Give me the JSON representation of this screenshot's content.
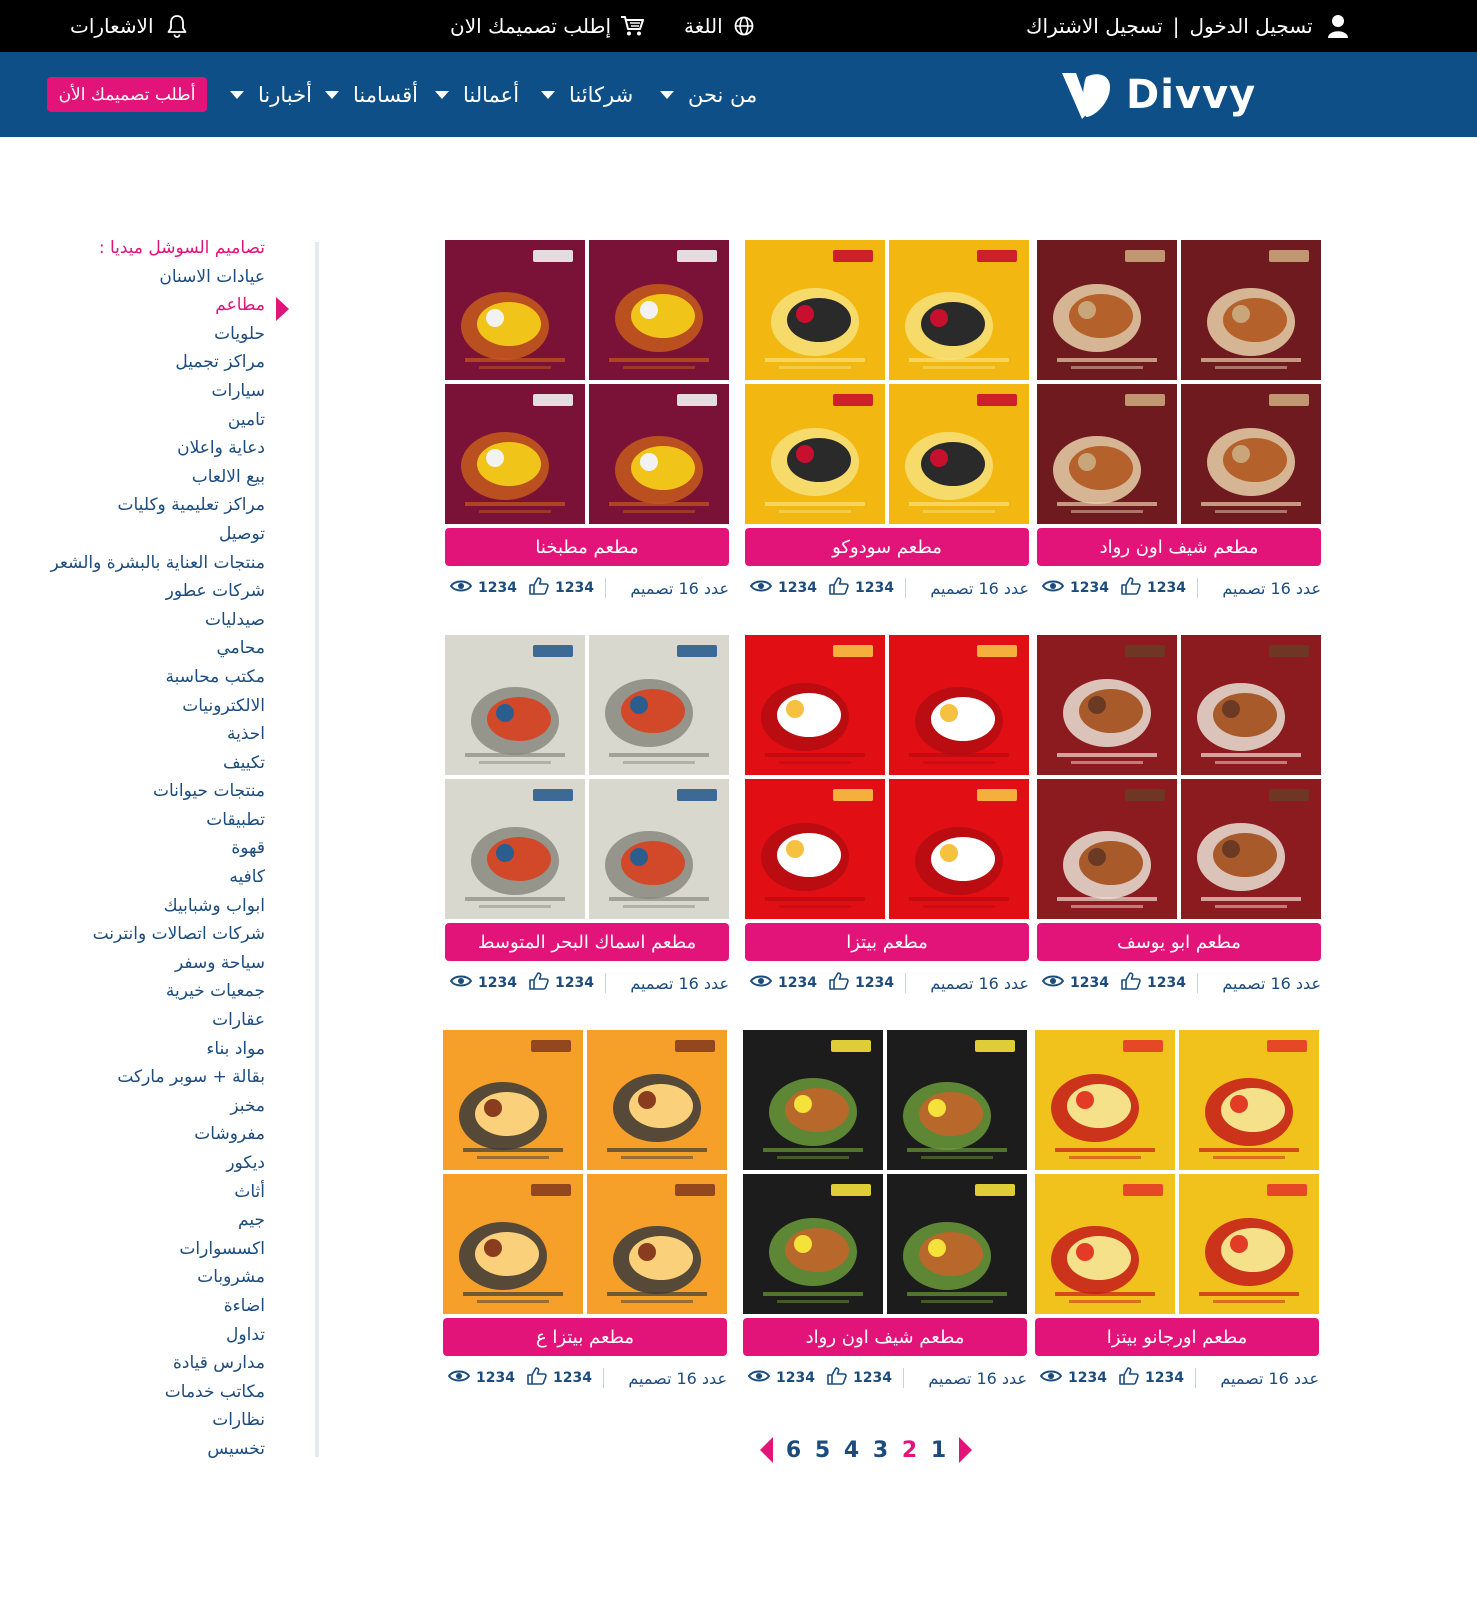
{
  "topbar": {
    "login": "تسجيل الدخول",
    "divider": "|",
    "register": "تسجيل الاشتراك",
    "language": "اللغة",
    "order_design": "إطلب تصميمك الان",
    "notifications": "الاشعارات"
  },
  "logo": {
    "text": "Divvy"
  },
  "nav": {
    "items": [
      "من نحن",
      "شركائنا",
      "أعمالنا",
      "أقسامنا",
      "أخبارنا"
    ],
    "cta": "أطلب تصميمك الأن"
  },
  "sidebar": {
    "title": "تصاميم السوشل ميديا :",
    "active_index": 1,
    "items": [
      "عيادات الاسنان",
      "مطاعم",
      "حلويات",
      "مراكز تجميل",
      "سيارات",
      "تامين",
      "دعاية واعلان",
      "بيع الالعاب",
      "مراكز تعليمية وكليات",
      "توصيل",
      "منتجات العناية بالبشرة والشعر",
      "شركات عطور",
      "صيدليات",
      "محامي",
      "مكتب محاسبة",
      "الالكترونيات",
      "احذية",
      "تكييف",
      "منتجات حيوانات",
      "تطبيقات",
      "قهوة",
      "كافيه",
      "ابواب وشبابيك",
      "شركات اتصالات وانترنت",
      "سياحة وسفر",
      "جمعيات خيرية",
      "عقارات",
      "مواد بناء",
      "بقالة + سوبر ماركت",
      "مخبز",
      "مفروشات",
      "ديكور",
      "أثاث",
      "جيم",
      "اكسسوارات",
      "مشروبات",
      "اضاءة",
      "تداول",
      "مدارس قيادة",
      "مكاتب خدمات",
      "نظارات",
      "تخسيس"
    ]
  },
  "cards": [
    {
      "title": "مطعم شيف اون رواد",
      "count_text": "عدد 16 تصميم",
      "likes": "1234",
      "views": "1234",
      "theme": "maroon",
      "bg": "#6e1a1e"
    },
    {
      "title": "مطعم سودوكو",
      "count_text": "عدد 16 تصميم",
      "likes": "1234",
      "views": "1234",
      "theme": "yellow",
      "bg": "#f3b711"
    },
    {
      "title": "مطعم مطبخنا",
      "count_text": "عدد 16 تصميم",
      "likes": "1234",
      "views": "1234",
      "theme": "plum",
      "bg": "#7a1136"
    },
    {
      "title": "مطعم ابو يوسف",
      "count_text": "عدد 16 تصميم",
      "likes": "1234",
      "views": "1234",
      "theme": "darkred",
      "bg": "#8c1b1f"
    },
    {
      "title": "مطعم بيتزا",
      "count_text": "عدد 16 تصميم",
      "likes": "1234",
      "views": "1234",
      "theme": "red",
      "bg": "#e10f14"
    },
    {
      "title": "مطعم اسماك البحر المتوسط",
      "count_text": "عدد 16 تصميم",
      "likes": "1234",
      "views": "1234",
      "theme": "cream",
      "bg": "#dcdcd4"
    },
    {
      "title": "مطعم اورجانو بيتزا",
      "count_text": "عدد 16 تصميم",
      "likes": "1234",
      "views": "1234",
      "theme": "gold",
      "bg": "#f2c21c"
    },
    {
      "title": "مطعم شيف اون رواد",
      "count_text": "عدد 16 تصميم",
      "likes": "1234",
      "views": "1234",
      "theme": "black",
      "bg": "#1c1c1c"
    },
    {
      "title": "مطعم بيتزا ع",
      "count_text": "عدد 16 تصميم",
      "likes": "1234",
      "views": "1234",
      "theme": "orange",
      "bg": "#f6a02a"
    }
  ],
  "pagination": {
    "pages": [
      "1",
      "2",
      "3",
      "4",
      "5",
      "6"
    ],
    "current": "2"
  },
  "colors": {
    "primary_blue": "#0d4f86",
    "accent_pink": "#e2147a",
    "text_blue": "#1c4c7e"
  }
}
